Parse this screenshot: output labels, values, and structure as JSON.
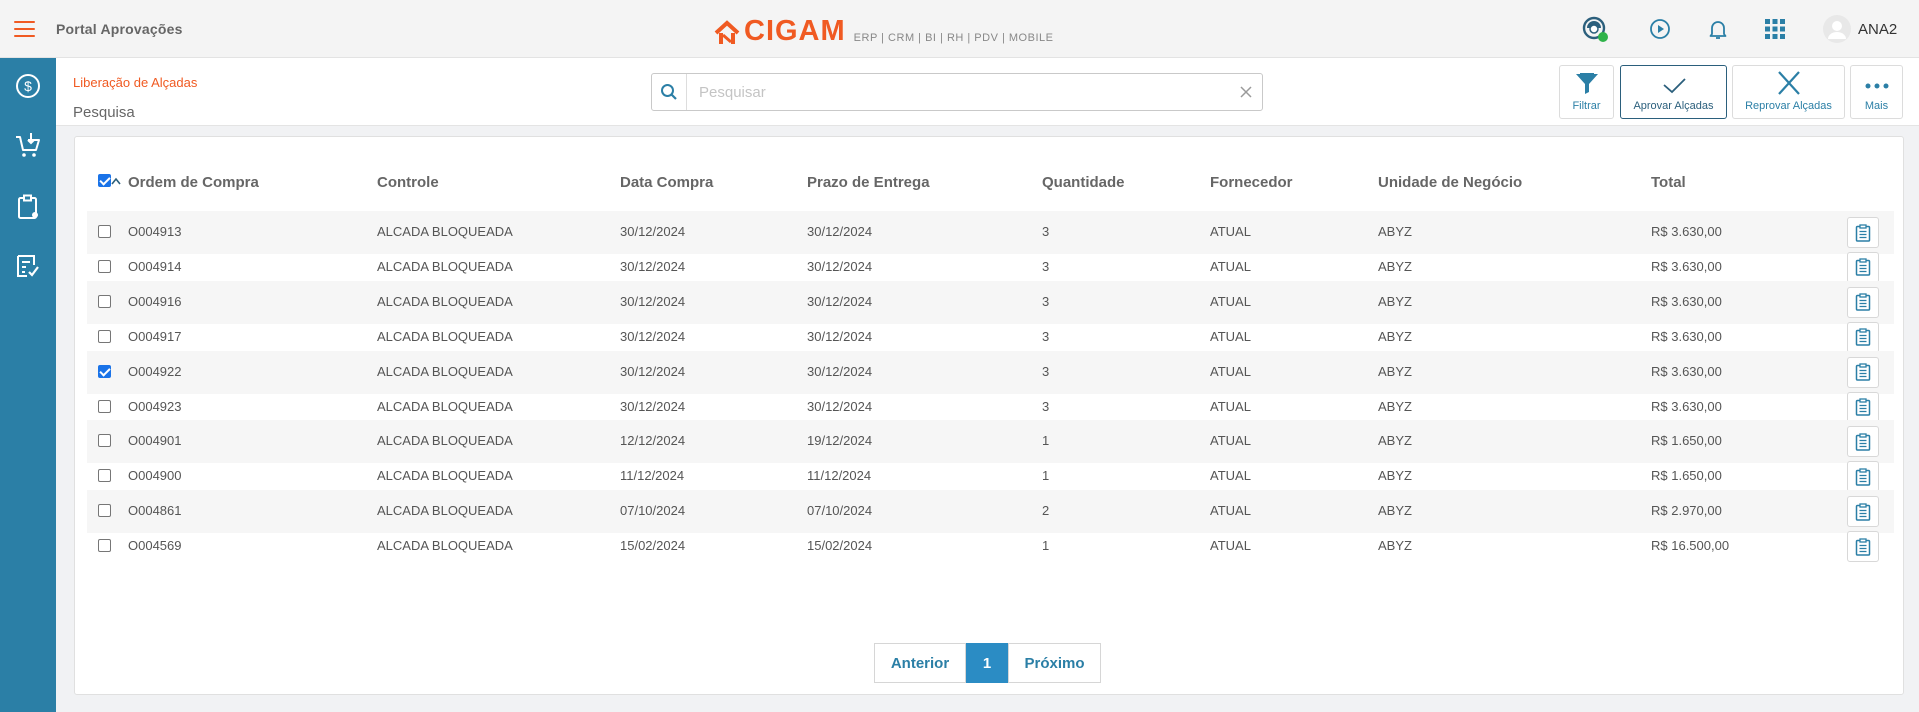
{
  "app": {
    "title": "Portal Aprovações"
  },
  "logo": {
    "word": "CIGAM",
    "sub": "ERP | CRM | BI | RH | PDV | MOBILE"
  },
  "topbar_icons": [
    "support-icon",
    "play-icon",
    "bell-icon",
    "apps-grid-icon"
  ],
  "user": {
    "name": "ANA2"
  },
  "sidebar": {
    "items": [
      "finance-icon",
      "purchase-cart-icon",
      "clipboard-icon",
      "approval-list-icon"
    ]
  },
  "header": {
    "breadcrumb": "Liberação de Alçadas",
    "title": "Pesquisa"
  },
  "search": {
    "placeholder": "Pesquisar",
    "value": ""
  },
  "actions": {
    "filter": "Filtrar",
    "approve": "Aprovar Alçadas",
    "reject": "Reprovar Alçadas",
    "more": "Mais"
  },
  "table": {
    "columns": [
      "Ordem de Compra",
      "Controle",
      "Data Compra",
      "Prazo de Entrega",
      "Quantidade",
      "Fornecedor",
      "Unidade de Negócio",
      "Total"
    ],
    "header_checked": true,
    "rows": [
      {
        "checked": false,
        "cells": [
          "O004913",
          "ALCADA BLOQUEADA",
          "30/12/2024",
          "30/12/2024",
          "3",
          "ATUAL",
          "ABYZ",
          "R$ 3.630,00"
        ]
      },
      {
        "checked": false,
        "cells": [
          "O004914",
          "ALCADA BLOQUEADA",
          "30/12/2024",
          "30/12/2024",
          "3",
          "ATUAL",
          "ABYZ",
          "R$ 3.630,00"
        ]
      },
      {
        "checked": false,
        "cells": [
          "O004916",
          "ALCADA BLOQUEADA",
          "30/12/2024",
          "30/12/2024",
          "3",
          "ATUAL",
          "ABYZ",
          "R$ 3.630,00"
        ]
      },
      {
        "checked": false,
        "cells": [
          "O004917",
          "ALCADA BLOQUEADA",
          "30/12/2024",
          "30/12/2024",
          "3",
          "ATUAL",
          "ABYZ",
          "R$ 3.630,00"
        ]
      },
      {
        "checked": true,
        "cells": [
          "O004922",
          "ALCADA BLOQUEADA",
          "30/12/2024",
          "30/12/2024",
          "3",
          "ATUAL",
          "ABYZ",
          "R$ 3.630,00"
        ]
      },
      {
        "checked": false,
        "cells": [
          "O004923",
          "ALCADA BLOQUEADA",
          "30/12/2024",
          "30/12/2024",
          "3",
          "ATUAL",
          "ABYZ",
          "R$ 3.630,00"
        ]
      },
      {
        "checked": false,
        "cells": [
          "O004901",
          "ALCADA BLOQUEADA",
          "12/12/2024",
          "19/12/2024",
          "1",
          "ATUAL",
          "ABYZ",
          "R$ 1.650,00"
        ]
      },
      {
        "checked": false,
        "cells": [
          "O004900",
          "ALCADA BLOQUEADA",
          "11/12/2024",
          "11/12/2024",
          "1",
          "ATUAL",
          "ABYZ",
          "R$ 1.650,00"
        ]
      },
      {
        "checked": false,
        "cells": [
          "O004861",
          "ALCADA BLOQUEADA",
          "07/10/2024",
          "07/10/2024",
          "2",
          "ATUAL",
          "ABYZ",
          "R$ 2.970,00"
        ]
      },
      {
        "checked": false,
        "cells": [
          "O004569",
          "ALCADA BLOQUEADA",
          "15/02/2024",
          "15/02/2024",
          "1",
          "ATUAL",
          "ABYZ",
          "R$ 16.500,00"
        ]
      }
    ]
  },
  "pagination": {
    "prev": "Anterior",
    "current": "1",
    "next": "Próximo"
  },
  "colors": {
    "accent": "#f05a22",
    "primary": "#2b7fa6",
    "sidebar": "#2b7fa6"
  }
}
